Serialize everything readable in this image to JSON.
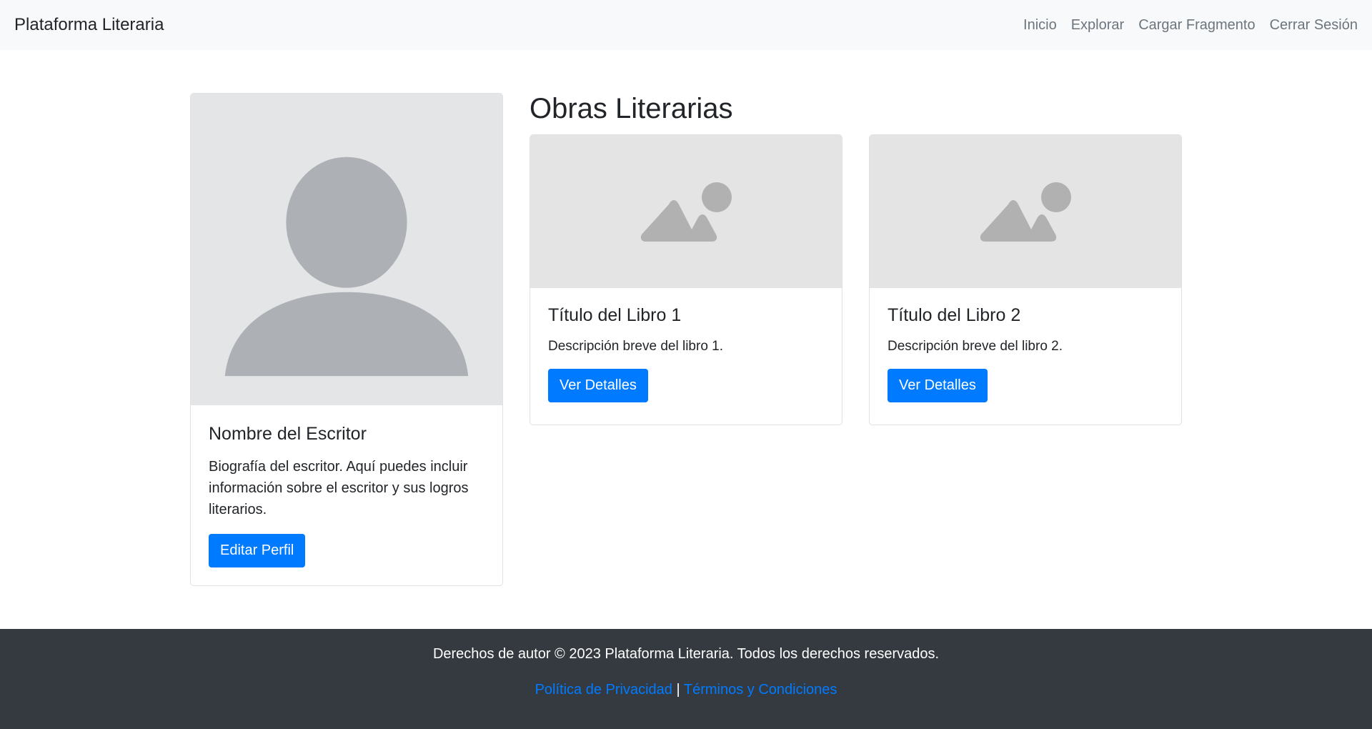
{
  "navbar": {
    "brand": "Plataforma Literaria",
    "links": [
      "Inicio",
      "Explorar",
      "Cargar Fragmento",
      "Cerrar Sesión"
    ]
  },
  "profile": {
    "name": "Nombre del Escritor",
    "bio": "Biografía del escritor. Aquí puedes incluir información sobre el escritor y sus logros literarios.",
    "edit_button": "Editar Perfil"
  },
  "works": {
    "title": "Obras Literarias",
    "books": [
      {
        "title": "Título del Libro 1",
        "description": "Descripción breve del libro 1.",
        "button": "Ver Detalles"
      },
      {
        "title": "Título del Libro 2",
        "description": "Descripción breve del libro 2.",
        "button": "Ver Detalles"
      }
    ]
  },
  "footer": {
    "copyright": "Derechos de autor © 2023 Plataforma Literaria. Todos los derechos reservados.",
    "privacy": "Política de Privacidad",
    "separator": "|",
    "terms": "Términos y Condiciones"
  },
  "colors": {
    "primary": "#007bff",
    "navbar_bg": "#f8f9fa",
    "footer_bg": "#343a40",
    "placeholder_bg": "#e4e5e7",
    "placeholder_icon": "#adb1b5"
  },
  "icons": {
    "avatar": "user-avatar-placeholder-icon",
    "book_image": "image-placeholder-icon"
  }
}
